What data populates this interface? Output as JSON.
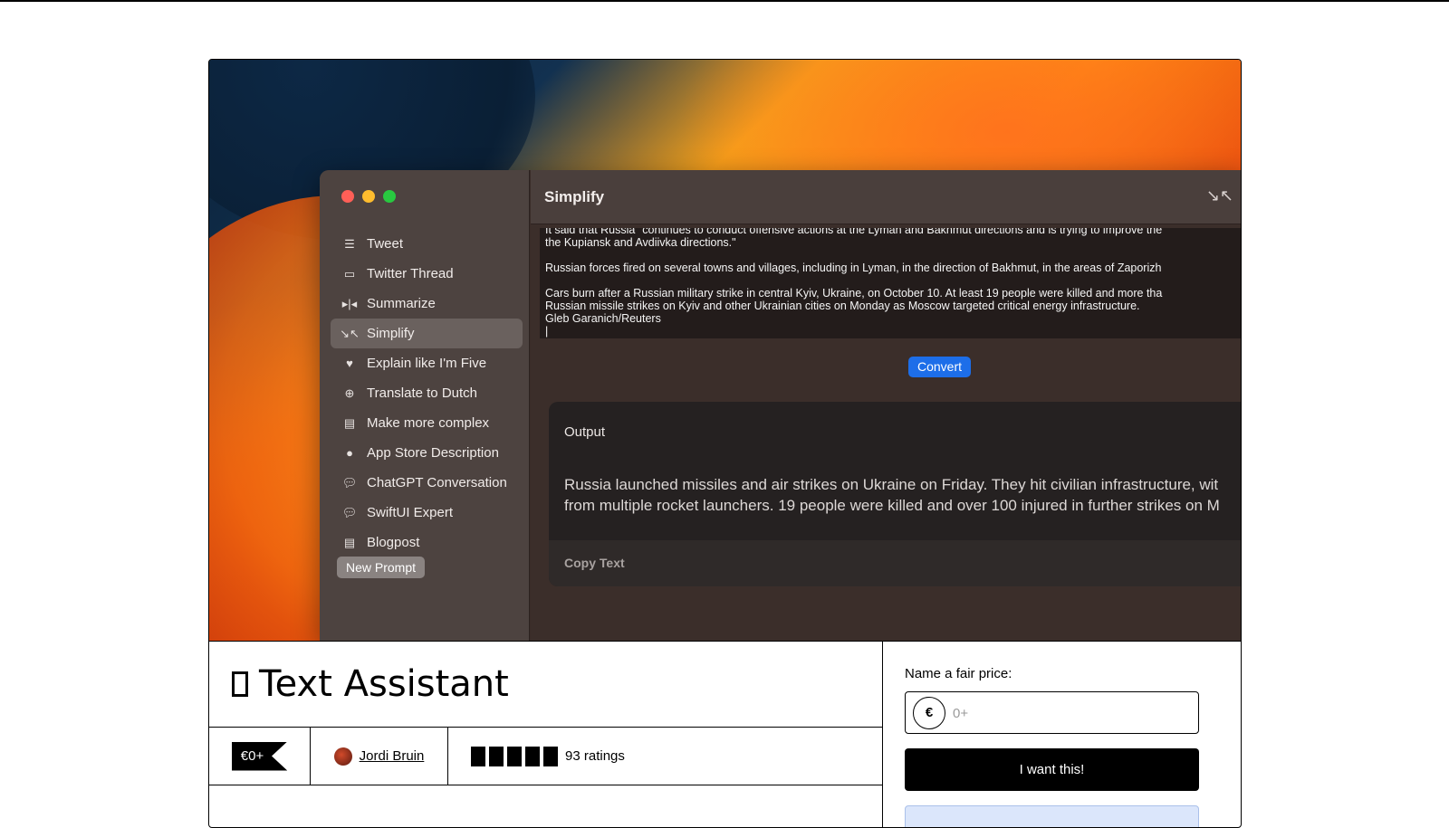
{
  "product": {
    "title": "Text Assistant",
    "price_tag": "€0+",
    "author": "Jordi Bruin",
    "ratings": "93 ratings",
    "rating_stars": 5
  },
  "purchase": {
    "label": "Name a fair price:",
    "currency": "€",
    "price_placeholder": "0+",
    "buy_label": "I want this!"
  },
  "app": {
    "sidebar": [
      {
        "icon": "list-icon",
        "label": "Tweet"
      },
      {
        "icon": "thread-icon",
        "label": "Twitter Thread"
      },
      {
        "icon": "summarize-icon",
        "label": "Summarize"
      },
      {
        "icon": "simplify-icon",
        "label": "Simplify"
      },
      {
        "icon": "heart-icon",
        "label": "Explain like I'm Five"
      },
      {
        "icon": "globe-icon",
        "label": "Translate to Dutch"
      },
      {
        "icon": "document-icon",
        "label": "Make more complex"
      },
      {
        "icon": "circle-icon",
        "label": "App Store Description"
      },
      {
        "icon": "chat-bubble-icon",
        "label": "ChatGPT Conversation"
      },
      {
        "icon": "chat-bubble-icon",
        "label": "SwiftUI Expert"
      },
      {
        "icon": "document-icon",
        "label": "Blogpost"
      }
    ],
    "active_index": 3,
    "new_prompt": "New Prompt",
    "window_title": "Simplify",
    "input_lines": [
      "It said that Russia \"continues to conduct offensive actions at the Lyman and Bakhmut directions and is trying to improve the",
      "the Kupiansk and Avdiivka directions.\"",
      "Russian forces fired on several towns and villages, including in Lyman, in the direction of Bakhmut, in the areas of Zaporizh",
      "Cars burn after a Russian military strike in central Kyiv, Ukraine, on October 10. At least 19 people were killed and more tha",
      "Russian missile strikes on Kyiv and other Ukrainian cities on Monday as Moscow targeted critical energy infrastructure.",
      "Gleb Garanich/Reuters"
    ],
    "convert": "Convert",
    "output_label": "Output",
    "output_lines": [
      "Russia launched missiles and air strikes on Ukraine on Friday. They hit civilian infrastructure, wit",
      "from multiple rocket launchers. 19 people were killed and over 100 injured in further strikes on M"
    ],
    "copy_text": "Copy Text"
  }
}
